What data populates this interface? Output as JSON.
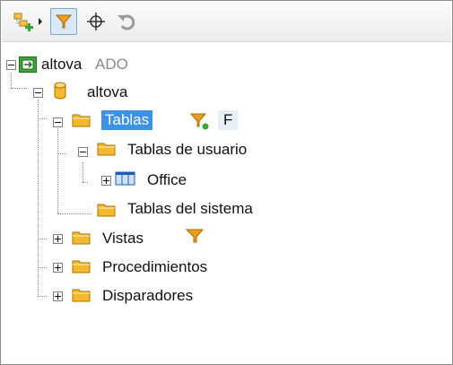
{
  "toolbar": {
    "buttons": [
      {
        "icon": "add-object-icon"
      },
      {
        "icon": "dropdown-arrow-icon"
      },
      {
        "icon": "filter-icon",
        "pressed": true
      },
      {
        "icon": "locate-icon"
      },
      {
        "icon": "refresh-icon"
      }
    ]
  },
  "tree": {
    "root": {
      "name": "altova",
      "suffix": "ADO"
    },
    "database": {
      "name": "altova"
    },
    "tablas": {
      "label": "Tablas",
      "filter_badge": "F"
    },
    "tablas_usuario": {
      "label": "Tablas de usuario"
    },
    "office": {
      "label": "Office"
    },
    "tablas_sistema": {
      "label": "Tablas del sistema"
    },
    "vistas": {
      "label": "Vistas"
    },
    "procedimientos": {
      "label": "Procedimientos"
    },
    "disparadores": {
      "label": "Disparadores"
    }
  },
  "colors": {
    "selection": "#3c92e6",
    "folder": "#f5b82e",
    "filter": "#e8a020",
    "accent_green": "#3aa635"
  }
}
